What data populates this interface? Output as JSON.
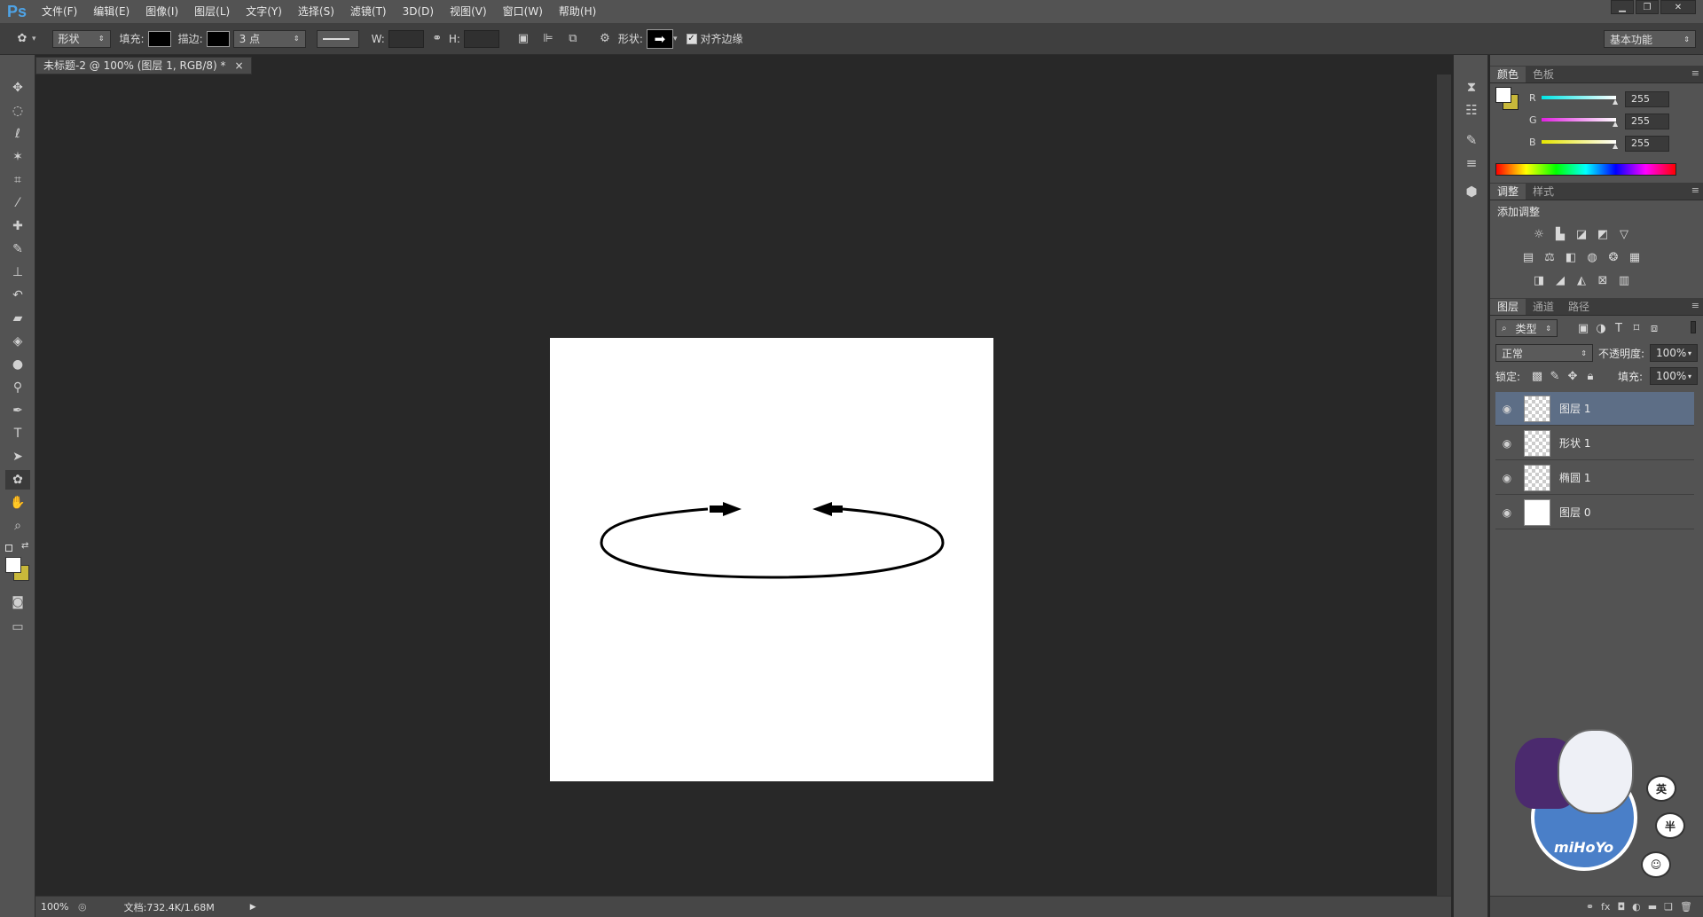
{
  "app": {
    "logo": "Ps"
  },
  "menu": [
    "文件(F)",
    "编辑(E)",
    "图像(I)",
    "图层(L)",
    "文字(Y)",
    "选择(S)",
    "滤镜(T)",
    "3D(D)",
    "视图(V)",
    "窗口(W)",
    "帮助(H)"
  ],
  "window_controls": [
    "▁",
    "❐",
    "✕"
  ],
  "options": {
    "mode": "形状",
    "fill_label": "填充:",
    "stroke_label": "描边:",
    "stroke_width": "3 点",
    "w_label": "W:",
    "h_label": "H:",
    "shape_label": "形状:",
    "align_edges": "对齐边缘",
    "workspace": "基本功能"
  },
  "document": {
    "tab_title": "未标题-2 @ 100% (图层 1, RGB/8) *",
    "close": "×"
  },
  "status": {
    "zoom": "100%",
    "doc_size": "文档:732.4K/1.68M"
  },
  "color_panel": {
    "tabs": [
      "颜色",
      "色板"
    ],
    "channels": [
      {
        "label": "R",
        "value": "255",
        "color": "#00e5e5"
      },
      {
        "label": "G",
        "value": "255",
        "color": "#e020e0"
      },
      {
        "label": "B",
        "value": "255",
        "color": "#e5e500"
      }
    ]
  },
  "adjust_panel": {
    "tabs": [
      "调整",
      "样式"
    ],
    "title": "添加调整"
  },
  "layers_panel": {
    "tabs": [
      "图层",
      "通道",
      "路径"
    ],
    "filter": "类型",
    "blend_mode": "正常",
    "opacity_label": "不透明度:",
    "opacity": "100%",
    "lock_label": "锁定:",
    "fill_label": "填充:",
    "fill": "100%",
    "layers": [
      {
        "name": "图层 1",
        "selected": true
      },
      {
        "name": "形状 1",
        "selected": false
      },
      {
        "name": "椭圆 1",
        "selected": false
      },
      {
        "name": "图层 0",
        "selected": false
      }
    ]
  },
  "watermark": {
    "speech": [
      "英",
      "半"
    ],
    "brand": "miHoYo"
  },
  "colors": {
    "foreground": "#ffffff",
    "background": "#c8b83a",
    "selected_layer": "#5d6e86"
  }
}
